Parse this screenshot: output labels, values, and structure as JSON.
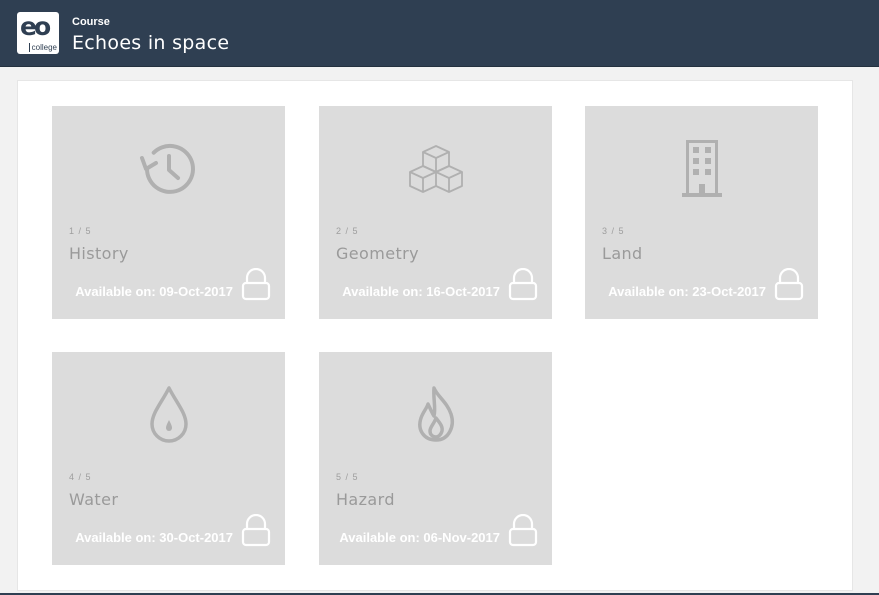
{
  "header": {
    "logo_letters": "eo",
    "logo_word": "college",
    "section_label": "Course",
    "title": "Echoes in space"
  },
  "units": [
    {
      "index": "1 / 5",
      "title": "History",
      "available": "Available on: 09-Oct-2017",
      "icon": "history-icon",
      "locked": true
    },
    {
      "index": "2 / 5",
      "title": "Geometry",
      "available": "Available on: 16-Oct-2017",
      "icon": "cubes-icon",
      "locked": true
    },
    {
      "index": "3 / 5",
      "title": "Land",
      "available": "Available on: 23-Oct-2017",
      "icon": "building-icon",
      "locked": true
    },
    {
      "index": "4 / 5",
      "title": "Water",
      "available": "Available on: 30-Oct-2017",
      "icon": "water-drop-icon",
      "locked": true
    },
    {
      "index": "5 / 5",
      "title": "Hazard",
      "available": "Available on: 06-Nov-2017",
      "icon": "fire-icon",
      "locked": true
    }
  ],
  "colors": {
    "header_bg": "#2f3f52",
    "card_bg": "#dcdcdc",
    "icon": "#b0b0b0"
  }
}
